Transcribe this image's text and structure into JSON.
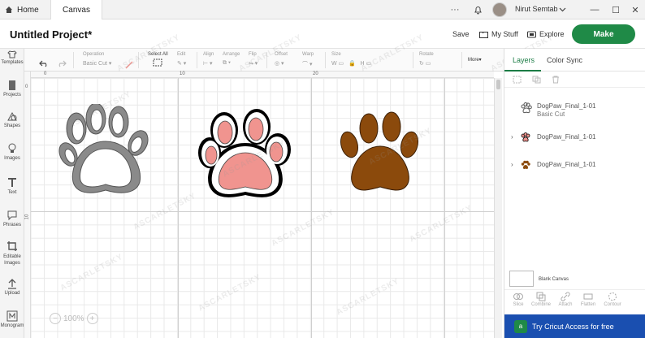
{
  "tabs": {
    "home": "Home",
    "canvas": "Canvas"
  },
  "user": {
    "name": "Nirut Semtab"
  },
  "header": {
    "title": "Untitled Project*",
    "save": "Save",
    "my_stuff": "My Stuff",
    "explore": "Explore",
    "make": "Make"
  },
  "sidebar": {
    "items": [
      {
        "label": "Templates",
        "icon": "tshirt-icon"
      },
      {
        "label": "Projects",
        "icon": "projects-icon"
      },
      {
        "label": "Shapes",
        "icon": "shapes-icon"
      },
      {
        "label": "Images",
        "icon": "lightbulb-icon"
      },
      {
        "label": "Text",
        "icon": "text-icon"
      },
      {
        "label": "Phrases",
        "icon": "speech-bubble-icon"
      },
      {
        "label": "Editable Images",
        "icon": "crop-icon"
      },
      {
        "label": "Upload",
        "icon": "upload-icon"
      },
      {
        "label": "Monogram",
        "icon": "monogram-icon"
      }
    ]
  },
  "toolbar": {
    "operation_label": "Operation",
    "operation_value": "Basic Cut",
    "select_all": "Select All",
    "edit": "Edit",
    "align": "Align",
    "arrange": "Arrange",
    "flip": "Flip",
    "offset": "Offset",
    "warp": "Warp",
    "size": "Size",
    "rotate": "Rotate",
    "more": "More▾"
  },
  "ruler": {
    "marks": [
      "0",
      "10",
      "20"
    ]
  },
  "zoom": {
    "value": "100%"
  },
  "panel": {
    "tab_layers": "Layers",
    "tab_colorsync": "Color Sync",
    "layers": [
      {
        "name": "DogPaw_Final_1-01",
        "sub": "Basic Cut",
        "color": "#888888"
      },
      {
        "name": "DogPaw_Final_1-01",
        "sub": "",
        "color": "#f0948f"
      },
      {
        "name": "DogPaw_Final_1-01",
        "sub": "",
        "color": "#8b4a0c"
      }
    ],
    "blank_canvas": "Blank Canvas",
    "bottom_tools": [
      "Slice",
      "Combine",
      "Attach",
      "Flatten",
      "Contour"
    ],
    "access_text": "Try Cricut Access for free"
  },
  "colors": {
    "make_green": "#1f8a47",
    "paw_gray": "#8a8a8a",
    "paw_pink": "#f0948f",
    "paw_brown": "#8b4a0c",
    "access_blue": "#1a4fb0"
  },
  "watermark": "ASCARLETSKY"
}
